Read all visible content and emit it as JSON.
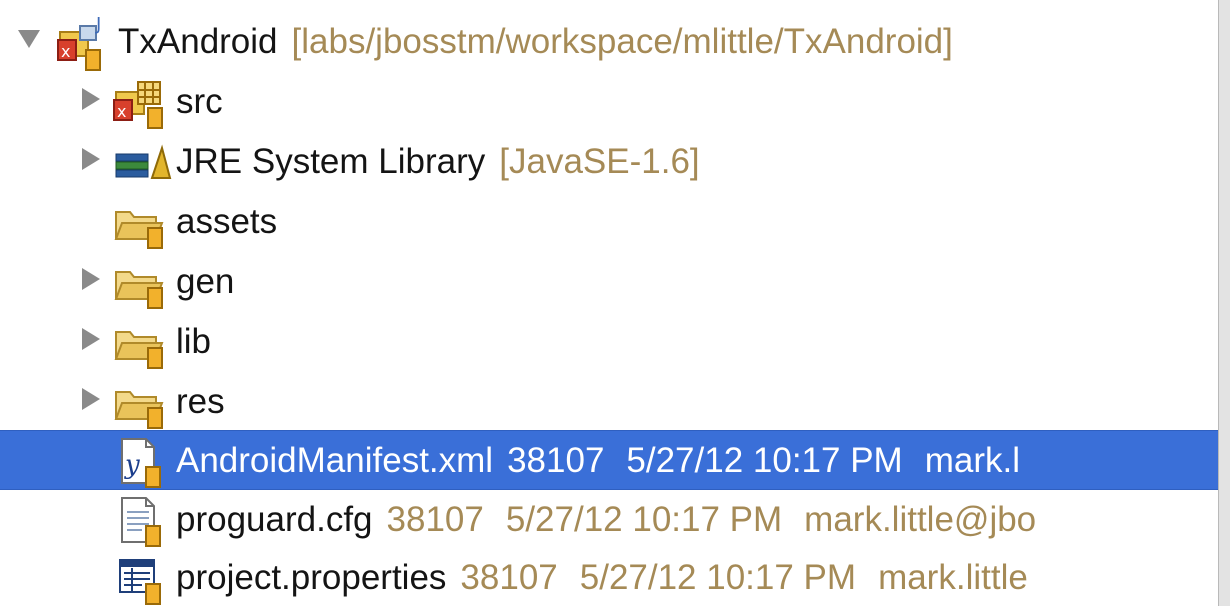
{
  "tree": {
    "root": {
      "name": "TxAndroid",
      "decoration": "[labs/jbosstm/workspace/mlittle/TxAndroid]",
      "expanded": true,
      "icon": "android-java-project-icon"
    },
    "items": [
      {
        "name": "src",
        "decoration": "",
        "expandable": true,
        "icon": "source-package-icon"
      },
      {
        "name": "JRE System Library",
        "decoration": "[JavaSE-1.6]",
        "expandable": true,
        "icon": "library-books-icon"
      },
      {
        "name": "assets",
        "decoration": "",
        "expandable": false,
        "icon": "folder-icon"
      },
      {
        "name": "gen",
        "decoration": "",
        "expandable": true,
        "icon": "folder-icon"
      },
      {
        "name": "lib",
        "decoration": "",
        "expandable": true,
        "icon": "folder-icon"
      },
      {
        "name": "res",
        "decoration": "",
        "expandable": true,
        "icon": "folder-icon"
      },
      {
        "name": "AndroidManifest.xml",
        "revision": "38107",
        "date": "5/27/12 10:17 PM",
        "author": "mark.l",
        "selected": true,
        "icon": "xml-file-icon"
      },
      {
        "name": "proguard.cfg",
        "revision": "38107",
        "date": "5/27/12 10:17 PM",
        "author": "mark.little@jbo",
        "selected": false,
        "icon": "text-file-icon"
      },
      {
        "name": "project.properties",
        "revision": "38107",
        "date": "5/27/12 10:17 PM",
        "author": "mark.little",
        "selected": false,
        "icon": "properties-file-icon"
      }
    ]
  },
  "colors": {
    "selection": "#3a6fd8",
    "decoration_text": "#a58a56",
    "folder": "#e9c35a",
    "repository_decorator": "#e0a520"
  }
}
